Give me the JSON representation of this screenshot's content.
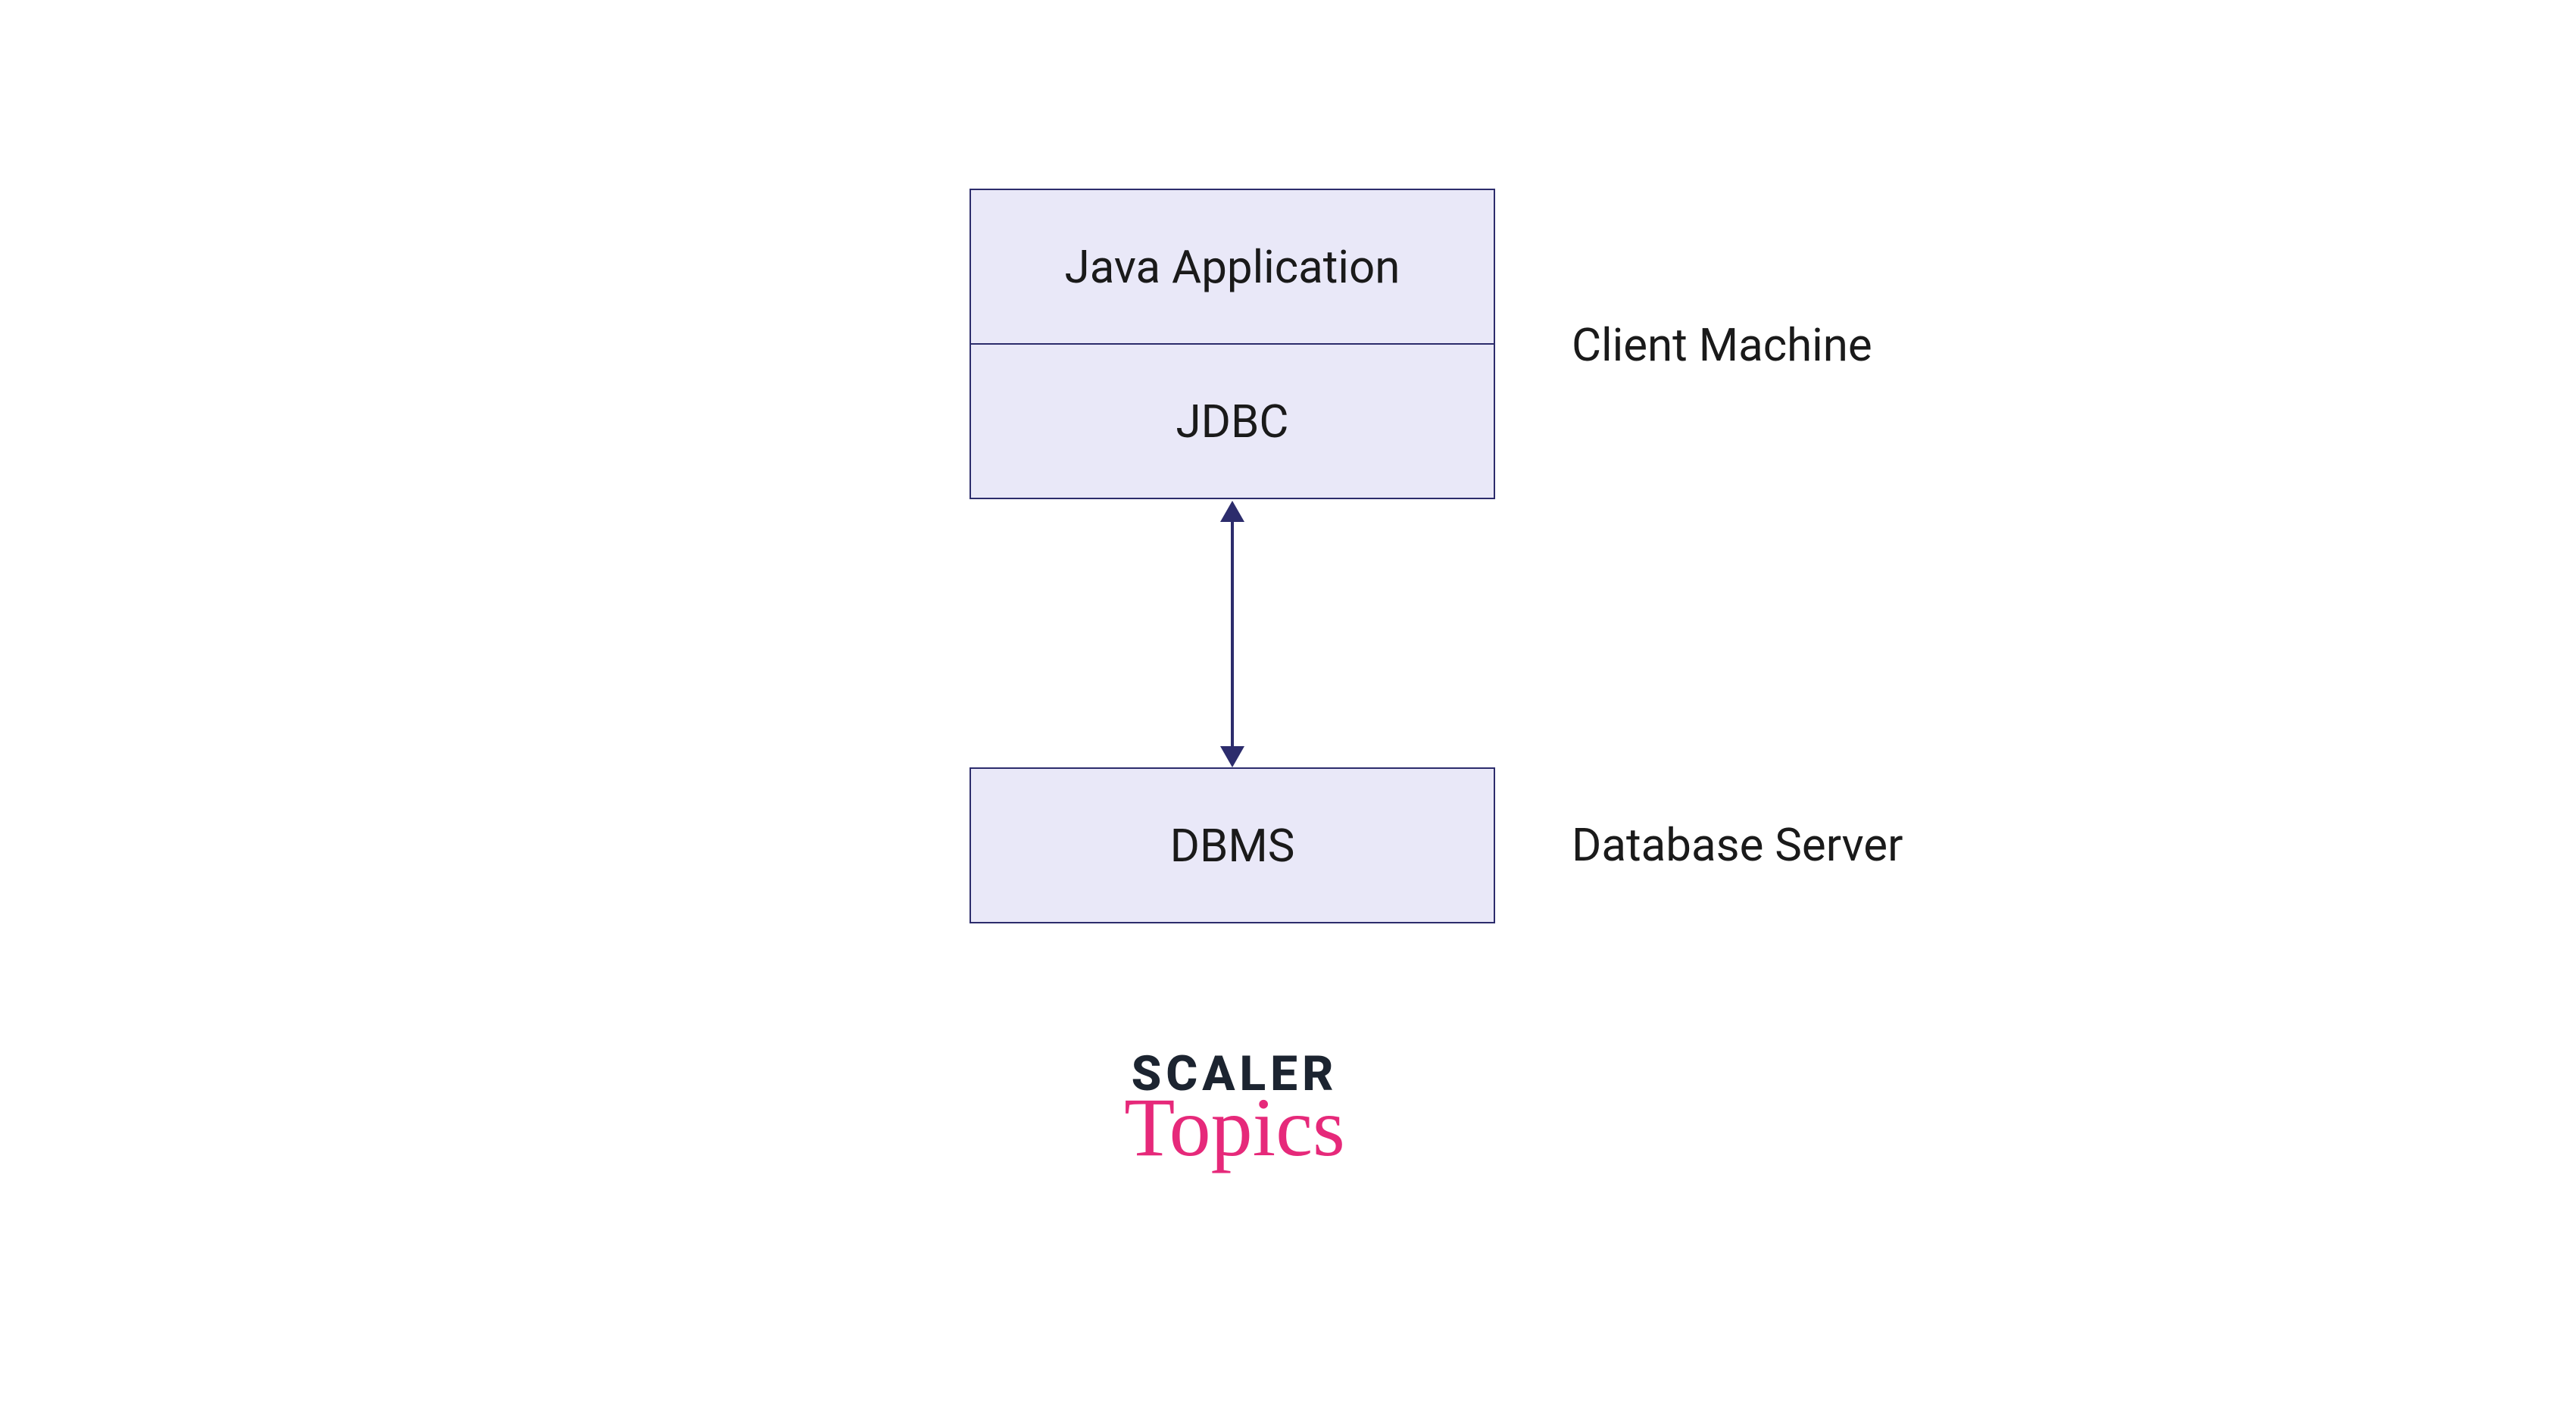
{
  "boxes": {
    "java_app": "Java Application",
    "jdbc": "JDBC",
    "dbms": "DBMS"
  },
  "labels": {
    "client": "Client Machine",
    "server": "Database Server"
  },
  "logo": {
    "line1": "SCALER",
    "line2": "Topics"
  },
  "colors": {
    "box_bg": "#e9e8f8",
    "box_border": "#2c2c6c",
    "text": "#1a1a1a",
    "logo_dark": "#1c2430",
    "logo_pink": "#e6297a"
  }
}
